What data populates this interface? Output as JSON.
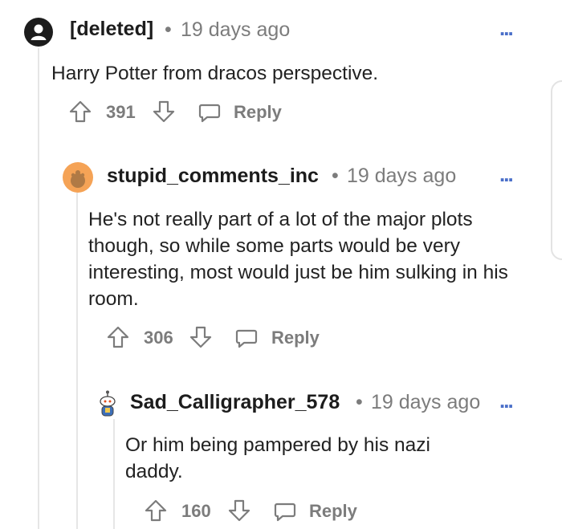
{
  "comments": [
    {
      "username": "[deleted]",
      "time": "19 days ago",
      "text": "Harry Potter from dracos perspective.",
      "votes": "391",
      "reply_label": "Reply",
      "avatar": "deleted-user-icon"
    },
    {
      "username": "stupid_comments_inc",
      "time": "19 days ago",
      "text": "He's not really part of a lot of the major plots though, so while some parts would be very interesting, most would just be him sulking in his room.",
      "votes": "306",
      "reply_label": "Reply",
      "avatar": "snoo-avatar-orange"
    },
    {
      "username": "Sad_Calligrapher_578",
      "time": "19 days ago",
      "text": "Or him being pampered by his nazi daddy.",
      "votes": "160",
      "reply_label": "Reply",
      "avatar": "snoo-avatar-small"
    }
  ],
  "separator": "•",
  "more_label": "...",
  "colors": {
    "username": "#1c1c1c",
    "meta": "#7c7c7c",
    "more": "#4a6fc9",
    "thread_line": "#e6e6e6",
    "avatar_orange": "#f5a356"
  }
}
